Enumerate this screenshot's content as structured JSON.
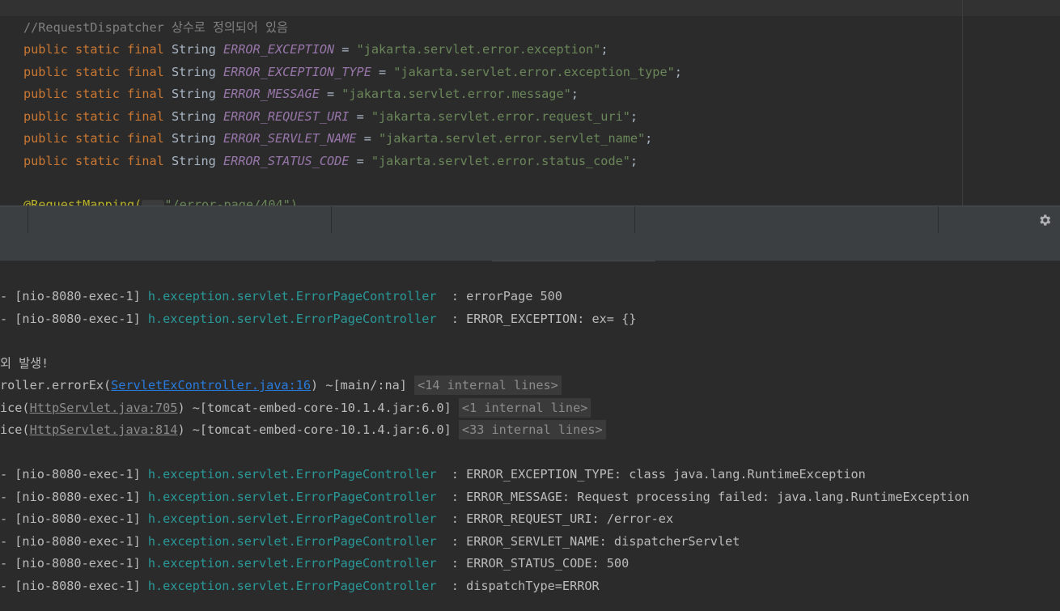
{
  "editor": {
    "comment": "//RequestDispatcher 상수로 정의되어 있음",
    "keyword_public": "public",
    "keyword_static": "static",
    "keyword_final": "final",
    "type_string": "String",
    "assign": " = ",
    "semicolon": ";",
    "constants": [
      {
        "name": "ERROR_EXCEPTION",
        "value": "\"jakarta.servlet.error.exception\""
      },
      {
        "name": "ERROR_EXCEPTION_TYPE",
        "value": "\"jakarta.servlet.error.exception_type\""
      },
      {
        "name": "ERROR_MESSAGE",
        "value": "\"jakarta.servlet.error.message\""
      },
      {
        "name": "ERROR_REQUEST_URI",
        "value": "\"jakarta.servlet.error.request_uri\""
      },
      {
        "name": "ERROR_SERVLET_NAME",
        "value": "\"jakarta.servlet.error.servlet_name\""
      },
      {
        "name": "ERROR_STATUS_CODE",
        "value": "\"jakarta.servlet.error.status_code\""
      }
    ],
    "annotation_partial": "@RequestMapping(",
    "annotation_path_partial": "\"/error-page/404\")"
  },
  "toolbar": {
    "settings_icon": "gear-icon"
  },
  "console": {
    "thread_prefix": "- [nio-8080-exec-1] ",
    "logger": "h.exception.servlet.ErrorPageController",
    "log_sep": "  : ",
    "messages_top": [
      "errorPage 500",
      "ERROR_EXCEPTION: ex= {}"
    ],
    "exception_msg": "외 발생!",
    "stack": [
      {
        "prefix": "roller.errorEx(",
        "link": "ServletExController.java:16",
        "suffix": ") ~[main/:na] ",
        "folded": "<14 internal lines>"
      },
      {
        "prefix": "ice(",
        "link": "HttpServlet.java:705",
        "suffix": ") ~[tomcat-embed-core-10.1.4.jar:6.0] ",
        "folded": "<1 internal line>"
      },
      {
        "prefix": "ice(",
        "link": "HttpServlet.java:814",
        "suffix": ") ~[tomcat-embed-core-10.1.4.jar:6.0] ",
        "folded": "<33 internal lines>"
      }
    ],
    "messages_bottom": [
      "ERROR_EXCEPTION_TYPE: class java.lang.RuntimeException",
      "ERROR_MESSAGE: Request processing failed: java.lang.RuntimeException",
      "ERROR_REQUEST_URI: /error-ex",
      "ERROR_SERVLET_NAME: dispatcherServlet",
      "ERROR_STATUS_CODE: 500",
      "dispatchType=ERROR"
    ]
  },
  "colors": {
    "editor_bg": "#2b2b2b",
    "keyword": "#cc7832",
    "constant": "#9876aa",
    "string": "#6a8759",
    "comment": "#808080",
    "logger": "#299999",
    "link": "#287bde"
  }
}
